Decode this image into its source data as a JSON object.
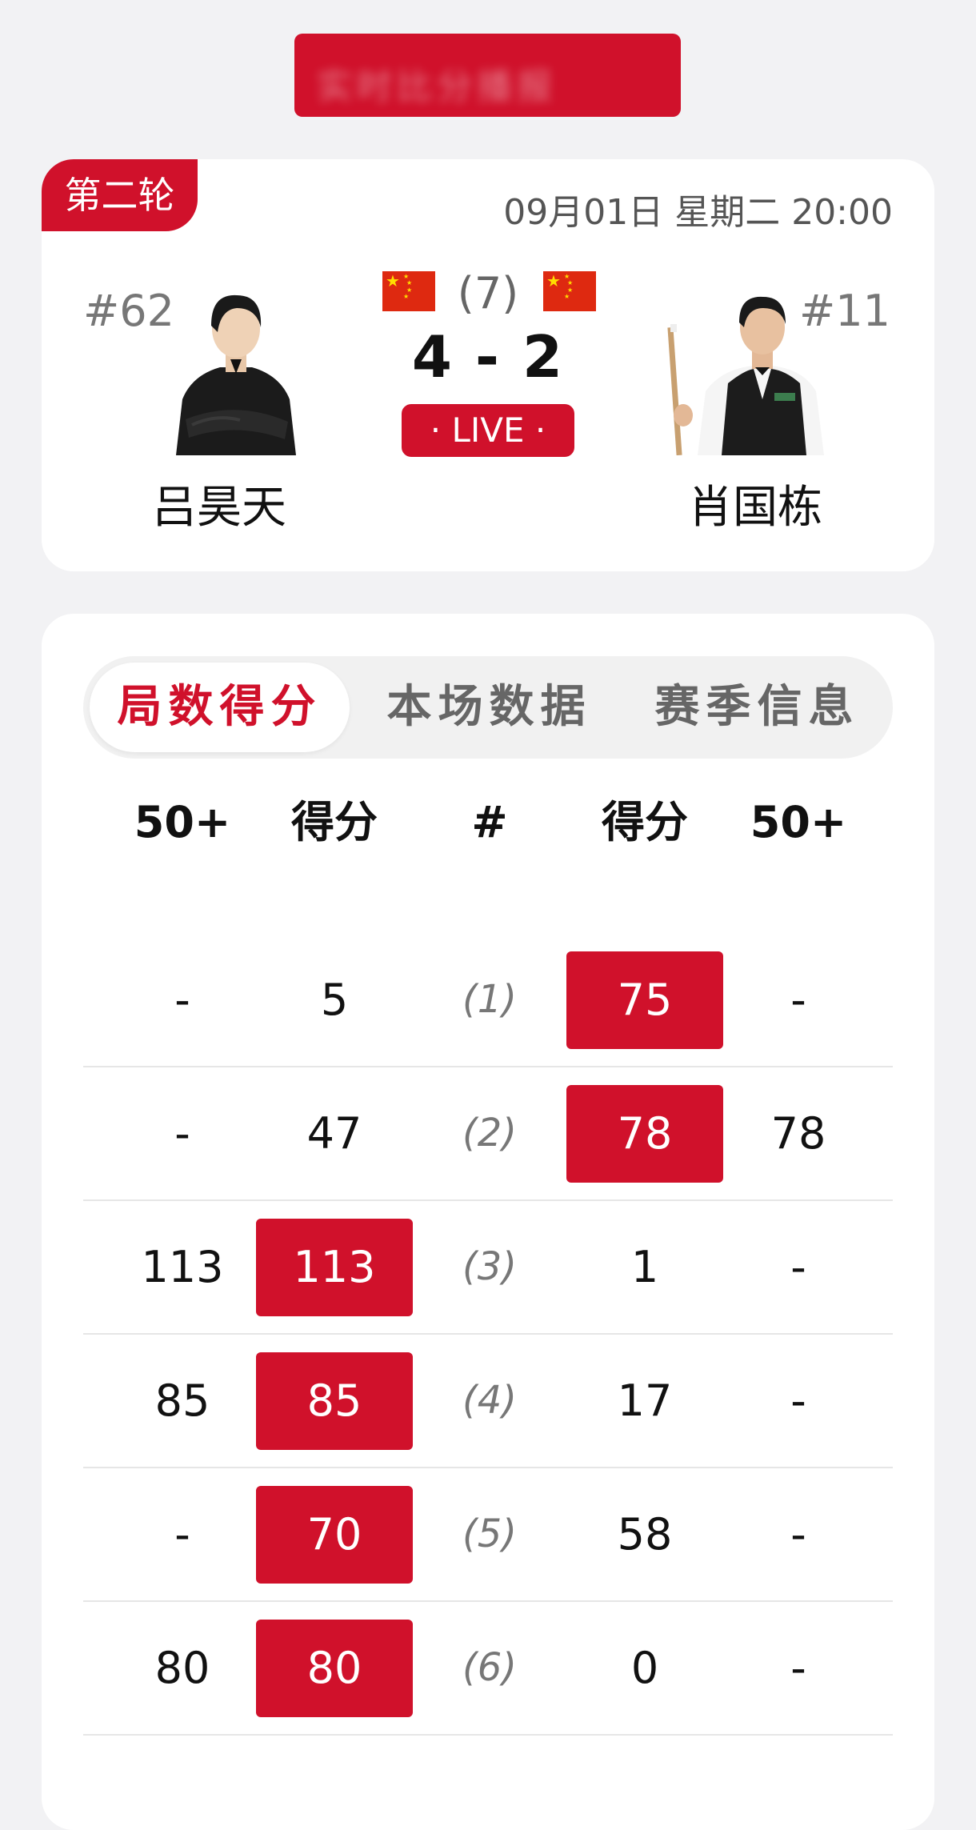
{
  "banner": {
    "text": "实时比分播报"
  },
  "match": {
    "round": "第二轮",
    "datetime": "09月01日 星期二 20:00",
    "best_of": "(7)",
    "score": "4 - 2",
    "status": "· LIVE ·",
    "player_left": {
      "rank": "#62",
      "name": "吕昊天",
      "flag": "china-flag"
    },
    "player_right": {
      "rank": "#11",
      "name": "肖国栋",
      "flag": "china-flag"
    }
  },
  "tabs": [
    {
      "label": "局数得分",
      "active": true
    },
    {
      "label": "本场数据",
      "active": false
    },
    {
      "label": "赛季信息",
      "active": false
    }
  ],
  "table": {
    "headers": [
      "50+",
      "得分",
      "#",
      "得分",
      "50+"
    ],
    "rows": [
      {
        "left_50": "-",
        "left_score": "5",
        "frame": "(1)",
        "right_score": "75",
        "right_50": "-",
        "winner": "right"
      },
      {
        "left_50": "-",
        "left_score": "47",
        "frame": "(2)",
        "right_score": "78",
        "right_50": "78",
        "winner": "right"
      },
      {
        "left_50": "113",
        "left_score": "113",
        "frame": "(3)",
        "right_score": "1",
        "right_50": "-",
        "winner": "left"
      },
      {
        "left_50": "85",
        "left_score": "85",
        "frame": "(4)",
        "right_score": "17",
        "right_50": "-",
        "winner": "left"
      },
      {
        "left_50": "-",
        "left_score": "70",
        "frame": "(5)",
        "right_score": "58",
        "right_50": "-",
        "winner": "left"
      },
      {
        "left_50": "80",
        "left_score": "80",
        "frame": "(6)",
        "right_score": "0",
        "right_50": "-",
        "winner": "left"
      }
    ]
  },
  "colors": {
    "accent": "#d0112b",
    "background": "#f2f2f4"
  }
}
